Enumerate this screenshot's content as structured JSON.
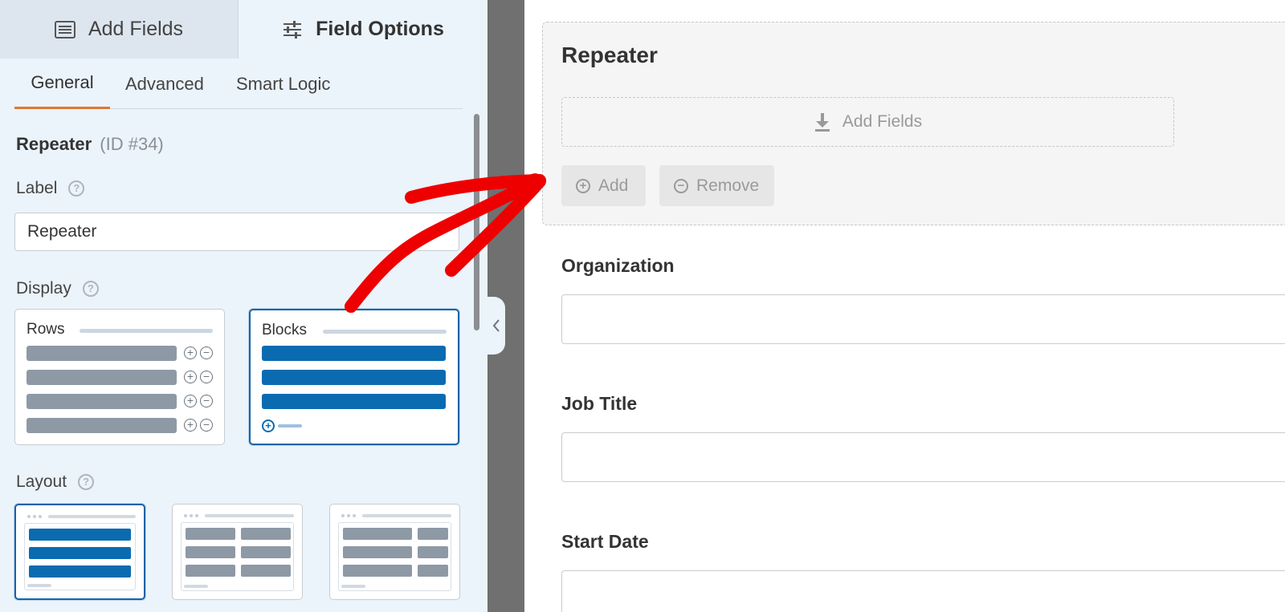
{
  "top_tabs": {
    "add_fields": "Add Fields",
    "field_options": "Field Options"
  },
  "sub_tabs": {
    "general": "General",
    "advanced": "Advanced",
    "smart_logic": "Smart Logic"
  },
  "field": {
    "name": "Repeater",
    "id_text": "(ID #34)"
  },
  "options": {
    "label_title": "Label",
    "label_value": "Repeater",
    "display_title": "Display",
    "display_rows": "Rows",
    "display_blocks": "Blocks",
    "display_selected": "Blocks",
    "layout_title": "Layout",
    "help_glyph": "?"
  },
  "preview": {
    "repeater_title": "Repeater",
    "add_fields": "Add Fields",
    "add_button": "Add",
    "remove_button": "Remove",
    "fields": [
      {
        "label": "Organization"
      },
      {
        "label": "Job Title"
      },
      {
        "label": "Start Date"
      }
    ]
  },
  "colors": {
    "accent_orange": "#e27730",
    "selected_blue": "#1763a6",
    "arrow_red": "#ee0000"
  }
}
